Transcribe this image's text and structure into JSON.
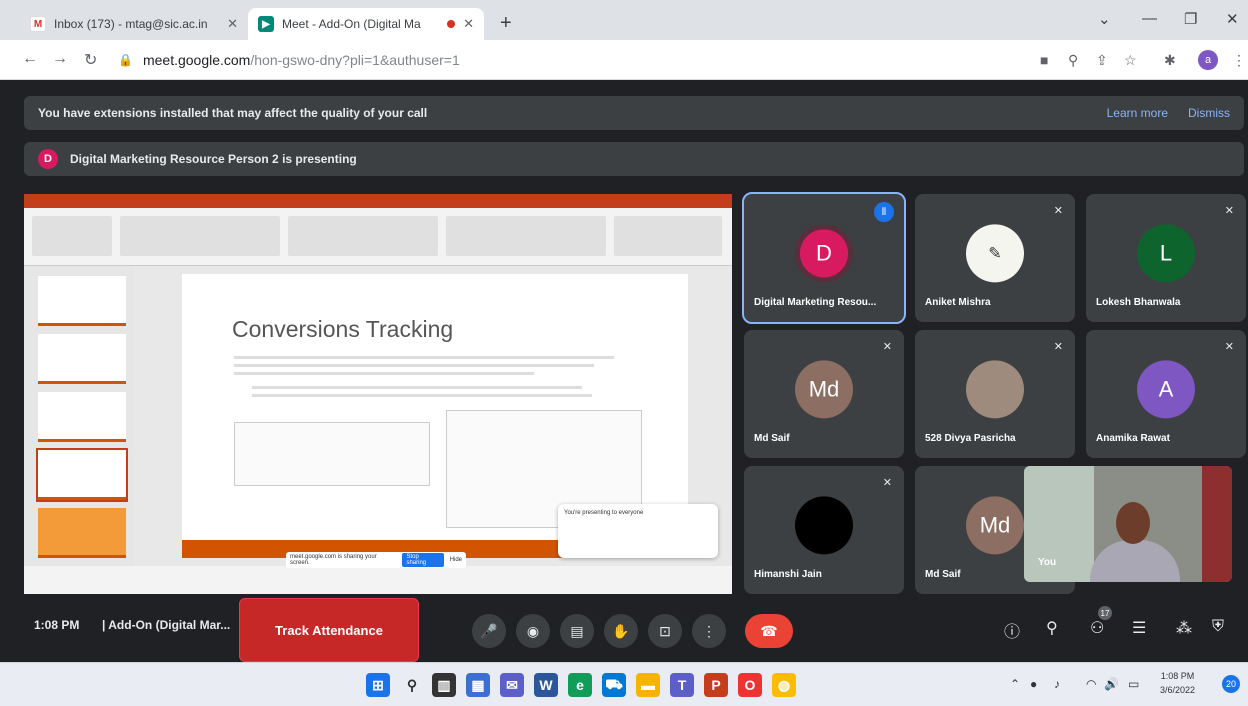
{
  "browser": {
    "tabs": [
      {
        "title": "Inbox (173) - mtag@sic.ac.in",
        "icon": "gmail-icon",
        "active": false
      },
      {
        "title": "Meet - Add-On (Digital Ma",
        "icon": "meet-icon",
        "active": true,
        "recording": true
      }
    ],
    "new_tab": "+",
    "url_host": "meet.google.com",
    "url_path": "/hon-gswo-dny?pli=1&authuser=1",
    "profile_initial": "a"
  },
  "meet": {
    "banner": {
      "message": "You have extensions installed that may affect the quality of your call",
      "learn_more": "Learn more",
      "dismiss": "Dismiss"
    },
    "presenting": {
      "initial": "D",
      "text": "Digital Marketing Resource Person 2 is presenting"
    },
    "slide": {
      "title": "Conversions Tracking",
      "share_bar_text": "meet.google.com is sharing your screen.",
      "share_bar_stop": "Stop sharing",
      "share_bar_hide": "Hide",
      "notice": "You're presenting to everyone"
    },
    "participants": [
      {
        "name": "Digital Marketing Resou...",
        "initial": "D",
        "color": "#d81b60",
        "speaking": true
      },
      {
        "name": "Aniket Mishra",
        "initial": "",
        "color": "#f5f5f0",
        "muted": true
      },
      {
        "name": "Lokesh Bhanwala",
        "initial": "L",
        "color": "#0d652d",
        "muted": true
      },
      {
        "name": "Md Saif",
        "initial": "Md",
        "color": "#8d6e63",
        "muted": true
      },
      {
        "name": "528 Divya Pasricha",
        "initial": "",
        "color": "#9e8b7d",
        "muted": true
      },
      {
        "name": "Anamika Rawat",
        "initial": "A",
        "color": "#7e57c2",
        "muted": true
      },
      {
        "name": "Himanshi Jain",
        "initial": "",
        "color": "#000000",
        "muted": true
      },
      {
        "name": "Md Saif",
        "initial": "Md",
        "color": "#8d6e63"
      }
    ],
    "self_label": "You",
    "time": "1:08 PM",
    "meeting_title": "Add-On (Digital Mar...",
    "track_attendance": "Track Attendance",
    "participant_count": "17"
  },
  "taskbar": {
    "clock_time": "1:08 PM",
    "clock_date": "3/6/2022",
    "notification_count": "20"
  },
  "colors": {
    "meet_bg": "#202124",
    "accent_blue": "#8ab4f8",
    "end_call_red": "#ea4335",
    "track_red": "#c62828"
  }
}
